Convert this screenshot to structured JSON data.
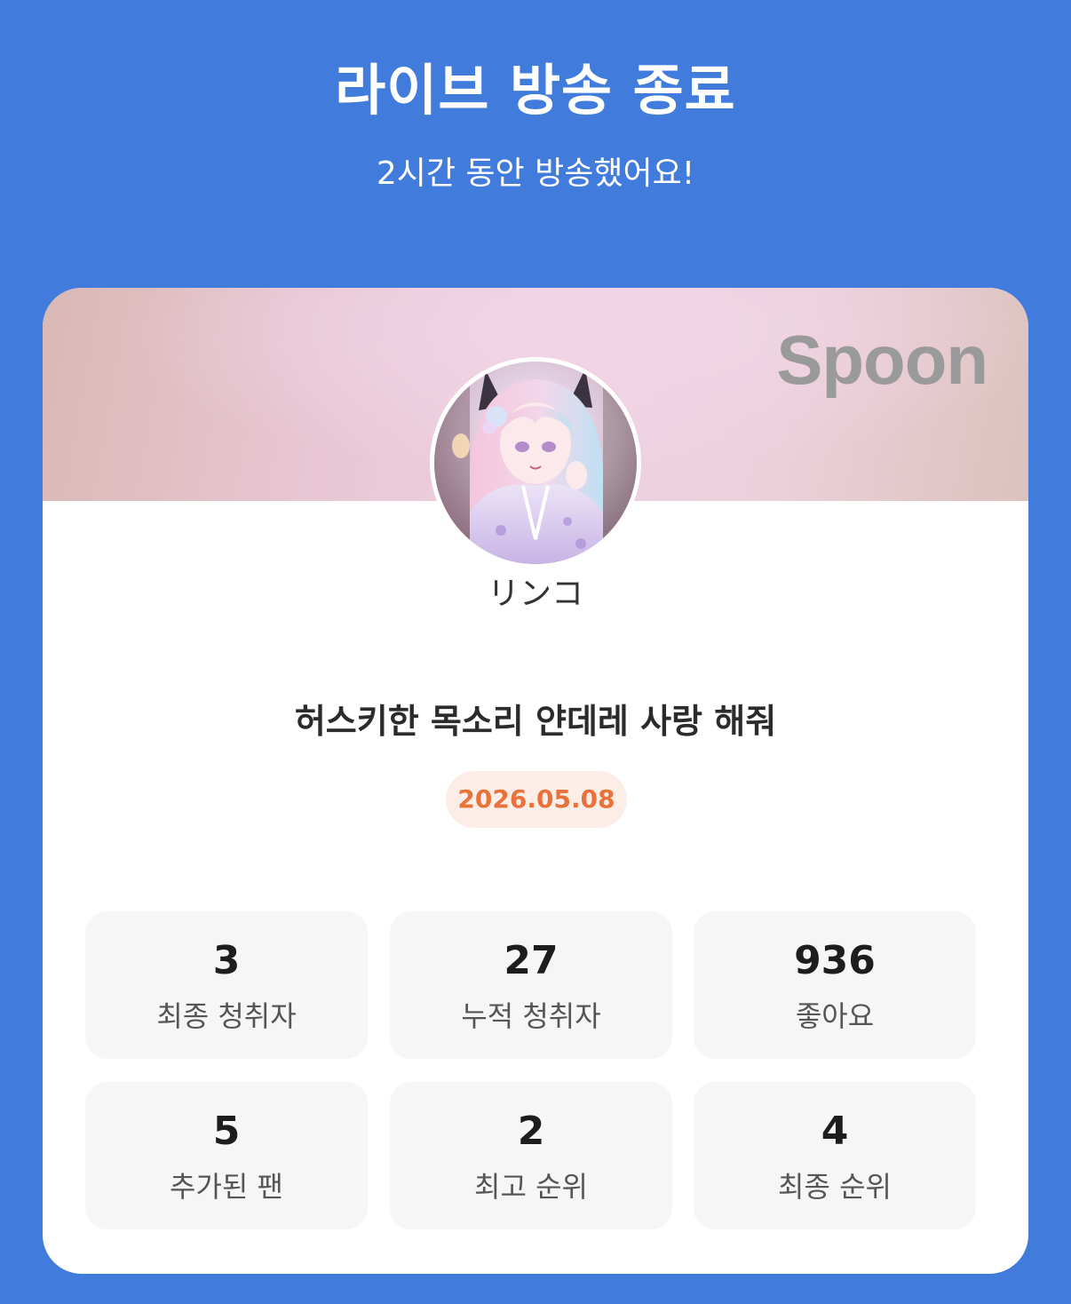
{
  "header": {
    "title": "라이브 방송 종료",
    "subtitle": "2시간 동안 방송했어요!"
  },
  "card": {
    "brand": "Spoon",
    "username": "リンコ",
    "live_title": "허스키한 목소리 얀데레 사랑 해줘",
    "date": "2026.05.08",
    "stats": [
      {
        "value": "3",
        "label": "최종 청취자"
      },
      {
        "value": "27",
        "label": "누적 청취자"
      },
      {
        "value": "936",
        "label": "좋아요"
      },
      {
        "value": "5",
        "label": "추가된 팬"
      },
      {
        "value": "2",
        "label": "최고 순위"
      },
      {
        "value": "4",
        "label": "최종 순위"
      }
    ]
  },
  "colors": {
    "background": "#417bdb",
    "date_text": "#e8733a",
    "date_bg": "#fcede6",
    "brand": "#9a9a9a"
  }
}
